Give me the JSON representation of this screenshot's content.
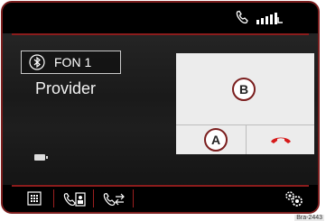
{
  "status": {
    "phone_icon": "phone-icon",
    "signal_icon": "signal-strength-icon"
  },
  "device": {
    "bluetooth_icon": "bluetooth-icon",
    "name": "FON 1"
  },
  "provider": "Provider",
  "battery_icon": "battery-icon",
  "panel": {
    "callout_b": "B",
    "callout_a": "A",
    "accept_icon": "accept-call-area",
    "hangup_icon": "hang-up-icon"
  },
  "bottom_bar": {
    "items": [
      {
        "name": "keypad-icon"
      },
      {
        "name": "phonebook-icon"
      },
      {
        "name": "call-list-icon"
      }
    ],
    "settings_icon": "settings-gear-icon"
  },
  "reference_code": "Bra-2443",
  "colors": {
    "accent": "#8b1c1c",
    "hangup_red": "#d61a1a",
    "panel_bg": "#ececec"
  }
}
